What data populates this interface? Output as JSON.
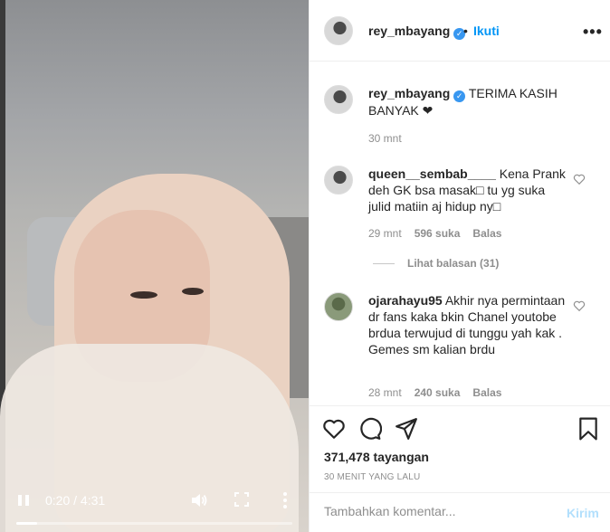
{
  "video": {
    "current_time": "0:20",
    "separator": "/",
    "duration": "4:31",
    "progress_fraction": 0.074
  },
  "header": {
    "username": "rey_mbayang",
    "verified_icon": "verified-badge-icon",
    "dot": "•",
    "follow_label": "Ikuti",
    "more_glyph": "•••"
  },
  "caption": {
    "username": "rey_mbayang",
    "text": "TERIMA KASIH BANYAK ❤",
    "time": "30 mnt"
  },
  "comments": [
    {
      "username": "queen__sembab____",
      "text": "Kena Prank deh GK bsa masak□ tu yg suka julid matiin aj hidup ny□",
      "time": "29 mnt",
      "likes": "596 suka",
      "reply": "Balas"
    },
    {
      "username": "ojarahayu95",
      "text": "Akhir nya permintaan dr fans kaka bkin Chanel youtobe brdua terwujud di tunggu yah kak . Gemes sm kalian brdu",
      "time": "28 mnt",
      "likes": "240 suka",
      "reply": "Balas"
    }
  ],
  "view_replies": "Lihat balasan (31)",
  "actions": {
    "views": "371,478 tayangan",
    "time_ago": "30 MENIT YANG LALU"
  },
  "comment_box": {
    "placeholder": "Tambahkan komentar...",
    "post_label": "Kirim"
  },
  "colors": {
    "accent": "#0095f6",
    "verified": "#3897f0",
    "muted": "#8e8e8e",
    "post_disabled": "#b2dffc"
  }
}
